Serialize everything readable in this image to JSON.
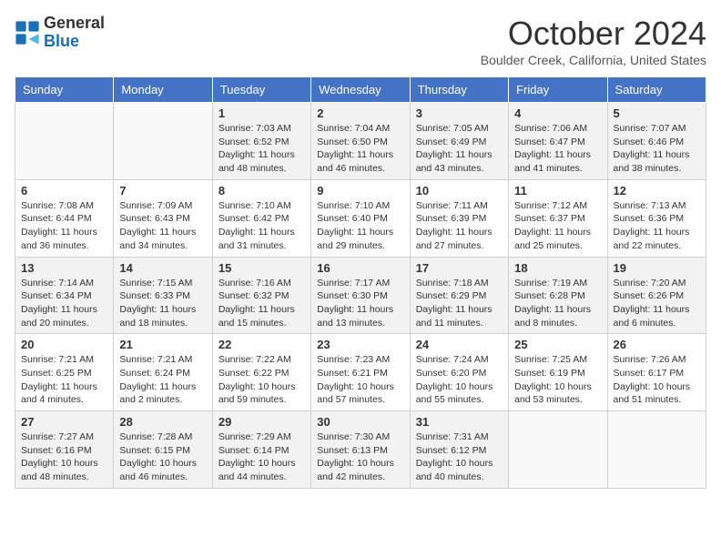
{
  "header": {
    "logo_line1": "General",
    "logo_line2": "Blue",
    "month_title": "October 2024",
    "subtitle": "Boulder Creek, California, United States"
  },
  "days_of_week": [
    "Sunday",
    "Monday",
    "Tuesday",
    "Wednesday",
    "Thursday",
    "Friday",
    "Saturday"
  ],
  "weeks": [
    [
      {
        "day": "",
        "info": ""
      },
      {
        "day": "",
        "info": ""
      },
      {
        "day": "1",
        "info": "Sunrise: 7:03 AM\nSunset: 6:52 PM\nDaylight: 11 hours and 48 minutes."
      },
      {
        "day": "2",
        "info": "Sunrise: 7:04 AM\nSunset: 6:50 PM\nDaylight: 11 hours and 46 minutes."
      },
      {
        "day": "3",
        "info": "Sunrise: 7:05 AM\nSunset: 6:49 PM\nDaylight: 11 hours and 43 minutes."
      },
      {
        "day": "4",
        "info": "Sunrise: 7:06 AM\nSunset: 6:47 PM\nDaylight: 11 hours and 41 minutes."
      },
      {
        "day": "5",
        "info": "Sunrise: 7:07 AM\nSunset: 6:46 PM\nDaylight: 11 hours and 38 minutes."
      }
    ],
    [
      {
        "day": "6",
        "info": "Sunrise: 7:08 AM\nSunset: 6:44 PM\nDaylight: 11 hours and 36 minutes."
      },
      {
        "day": "7",
        "info": "Sunrise: 7:09 AM\nSunset: 6:43 PM\nDaylight: 11 hours and 34 minutes."
      },
      {
        "day": "8",
        "info": "Sunrise: 7:10 AM\nSunset: 6:42 PM\nDaylight: 11 hours and 31 minutes."
      },
      {
        "day": "9",
        "info": "Sunrise: 7:10 AM\nSunset: 6:40 PM\nDaylight: 11 hours and 29 minutes."
      },
      {
        "day": "10",
        "info": "Sunrise: 7:11 AM\nSunset: 6:39 PM\nDaylight: 11 hours and 27 minutes."
      },
      {
        "day": "11",
        "info": "Sunrise: 7:12 AM\nSunset: 6:37 PM\nDaylight: 11 hours and 25 minutes."
      },
      {
        "day": "12",
        "info": "Sunrise: 7:13 AM\nSunset: 6:36 PM\nDaylight: 11 hours and 22 minutes."
      }
    ],
    [
      {
        "day": "13",
        "info": "Sunrise: 7:14 AM\nSunset: 6:34 PM\nDaylight: 11 hours and 20 minutes."
      },
      {
        "day": "14",
        "info": "Sunrise: 7:15 AM\nSunset: 6:33 PM\nDaylight: 11 hours and 18 minutes."
      },
      {
        "day": "15",
        "info": "Sunrise: 7:16 AM\nSunset: 6:32 PM\nDaylight: 11 hours and 15 minutes."
      },
      {
        "day": "16",
        "info": "Sunrise: 7:17 AM\nSunset: 6:30 PM\nDaylight: 11 hours and 13 minutes."
      },
      {
        "day": "17",
        "info": "Sunrise: 7:18 AM\nSunset: 6:29 PM\nDaylight: 11 hours and 11 minutes."
      },
      {
        "day": "18",
        "info": "Sunrise: 7:19 AM\nSunset: 6:28 PM\nDaylight: 11 hours and 8 minutes."
      },
      {
        "day": "19",
        "info": "Sunrise: 7:20 AM\nSunset: 6:26 PM\nDaylight: 11 hours and 6 minutes."
      }
    ],
    [
      {
        "day": "20",
        "info": "Sunrise: 7:21 AM\nSunset: 6:25 PM\nDaylight: 11 hours and 4 minutes."
      },
      {
        "day": "21",
        "info": "Sunrise: 7:21 AM\nSunset: 6:24 PM\nDaylight: 11 hours and 2 minutes."
      },
      {
        "day": "22",
        "info": "Sunrise: 7:22 AM\nSunset: 6:22 PM\nDaylight: 10 hours and 59 minutes."
      },
      {
        "day": "23",
        "info": "Sunrise: 7:23 AM\nSunset: 6:21 PM\nDaylight: 10 hours and 57 minutes."
      },
      {
        "day": "24",
        "info": "Sunrise: 7:24 AM\nSunset: 6:20 PM\nDaylight: 10 hours and 55 minutes."
      },
      {
        "day": "25",
        "info": "Sunrise: 7:25 AM\nSunset: 6:19 PM\nDaylight: 10 hours and 53 minutes."
      },
      {
        "day": "26",
        "info": "Sunrise: 7:26 AM\nSunset: 6:17 PM\nDaylight: 10 hours and 51 minutes."
      }
    ],
    [
      {
        "day": "27",
        "info": "Sunrise: 7:27 AM\nSunset: 6:16 PM\nDaylight: 10 hours and 48 minutes."
      },
      {
        "day": "28",
        "info": "Sunrise: 7:28 AM\nSunset: 6:15 PM\nDaylight: 10 hours and 46 minutes."
      },
      {
        "day": "29",
        "info": "Sunrise: 7:29 AM\nSunset: 6:14 PM\nDaylight: 10 hours and 44 minutes."
      },
      {
        "day": "30",
        "info": "Sunrise: 7:30 AM\nSunset: 6:13 PM\nDaylight: 10 hours and 42 minutes."
      },
      {
        "day": "31",
        "info": "Sunrise: 7:31 AM\nSunset: 6:12 PM\nDaylight: 10 hours and 40 minutes."
      },
      {
        "day": "",
        "info": ""
      },
      {
        "day": "",
        "info": ""
      }
    ]
  ]
}
